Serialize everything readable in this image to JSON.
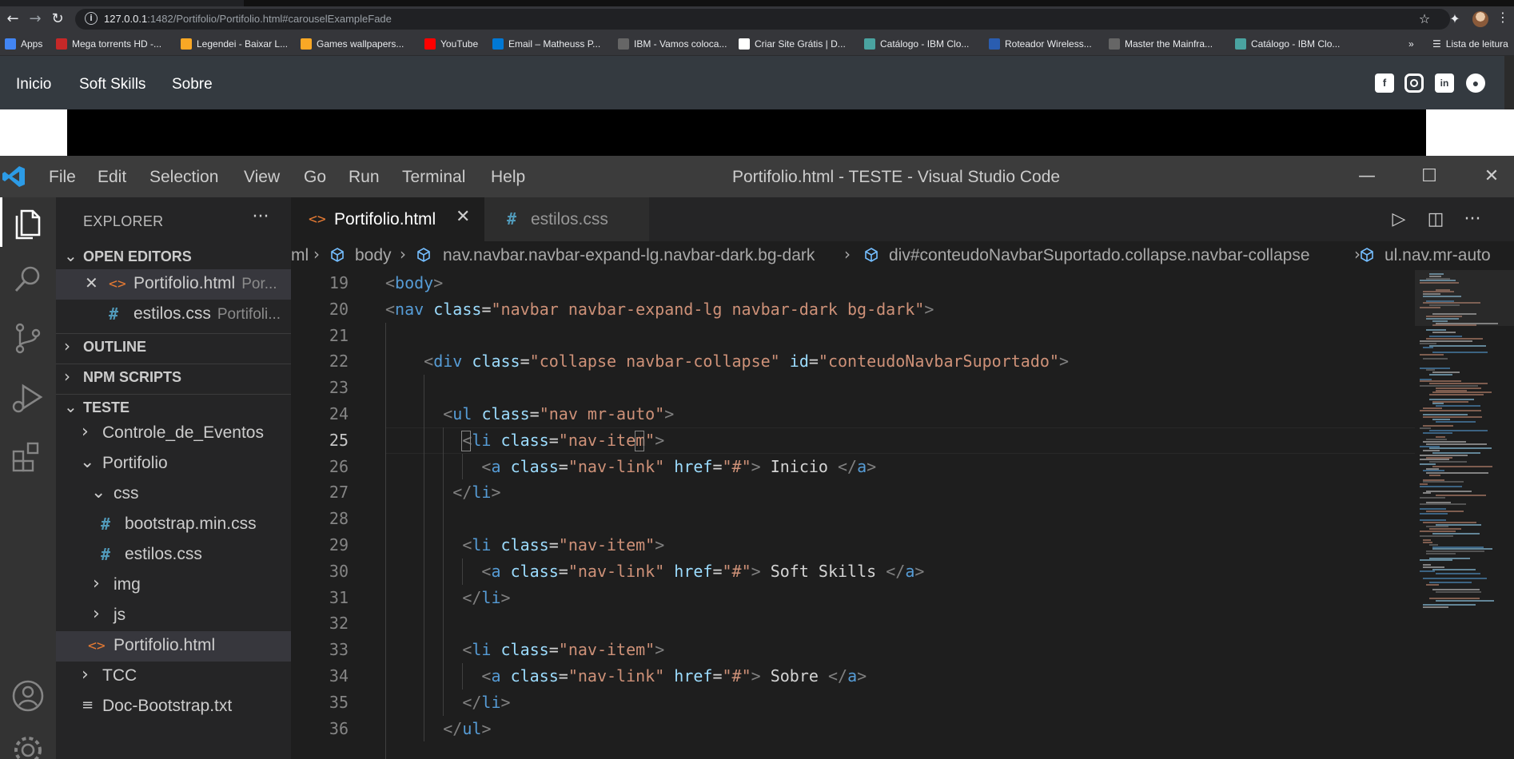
{
  "browser": {
    "url_host": "127.0.0.1",
    "url_rest": ":1482/Portifolio/Portifolio.html#carouselExampleFade",
    "bookmarks": [
      {
        "label": "Apps",
        "icon": "apps-grid-icon",
        "color": "#4285f4"
      },
      {
        "label": "Mega torrents HD -...",
        "icon": "hd-icon",
        "color": "#c62828"
      },
      {
        "label": "Legendei - Baixar L...",
        "icon": "legendei-icon",
        "color": "#f9a825"
      },
      {
        "label": "Games wallpapers...",
        "icon": "games-icon",
        "color": "#f9a825"
      },
      {
        "label": "YouTube",
        "icon": "youtube-icon",
        "color": "#ff0000"
      },
      {
        "label": "Email – Matheuss P...",
        "icon": "outlook-icon",
        "color": "#0078d4"
      },
      {
        "label": "IBM - Vamos coloca...",
        "icon": "ibm-icon",
        "color": "#666666"
      },
      {
        "label": "Criar Site Grátis | D...",
        "icon": "wix-icon",
        "color": "#ffffff"
      },
      {
        "label": "Catálogo - IBM Clo...",
        "icon": "ibm-cloud-icon",
        "color": "#4aa3a0"
      },
      {
        "label": "Roteador Wireless...",
        "icon": "router-icon",
        "color": "#2a5db0"
      },
      {
        "label": "Master the Mainfra...",
        "icon": "ibm-icon",
        "color": "#666666"
      },
      {
        "label": "Catálogo - IBM Clo...",
        "icon": "ibm-cloud-icon",
        "color": "#4aa3a0"
      }
    ],
    "more_bookmarks": "»",
    "reading_list": "Lista de leitura"
  },
  "site": {
    "nav": [
      "Inicio",
      "Soft Skills",
      "Sobre"
    ],
    "social": [
      "facebook-icon",
      "instagram-icon",
      "linkedin-icon",
      "github-icon"
    ],
    "bg_color": "#343a40"
  },
  "vscode": {
    "menu": [
      "File",
      "Edit",
      "Selection",
      "View",
      "Go",
      "Run",
      "Terminal",
      "Help"
    ],
    "window_title": "Portifolio.html - TESTE - Visual Studio Code",
    "explorer": {
      "header": "EXPLORER",
      "open_editors_label": "OPEN EDITORS",
      "open_editors": [
        {
          "name": "Portifolio.html",
          "desc": "Por...",
          "type": "html"
        },
        {
          "name": "estilos.css",
          "desc": "Portifoli...",
          "type": "css"
        }
      ],
      "outline_label": "OUTLINE",
      "npm_label": "NPM SCRIPTS",
      "workspace_label": "TESTE",
      "tree": [
        {
          "name": "Controle_de_Eventos",
          "type": "folder",
          "expanded": false
        },
        {
          "name": "Portifolio",
          "type": "folder",
          "expanded": true
        },
        {
          "name": "css",
          "type": "folder",
          "expanded": true
        },
        {
          "name": "bootstrap.min.css",
          "type": "css"
        },
        {
          "name": "estilos.css",
          "type": "css"
        },
        {
          "name": "img",
          "type": "folder",
          "expanded": false
        },
        {
          "name": "js",
          "type": "folder",
          "expanded": false
        },
        {
          "name": "Portifolio.html",
          "type": "html"
        },
        {
          "name": "TCC",
          "type": "folder",
          "expanded": false
        },
        {
          "name": "Doc-Bootstrap.txt",
          "type": "txt"
        }
      ]
    },
    "tabs": [
      {
        "label": "Portifolio.html",
        "active": true
      },
      {
        "label": "estilos.css",
        "active": false
      }
    ],
    "breadcrumb": [
      "ml",
      "body",
      "nav.navbar.navbar-expand-lg.navbar-dark.bg-dark",
      "div#conteudoNavbarSuportado.collapse.navbar-collapse",
      "ul.nav.mr-auto"
    ],
    "current_line": 25,
    "code_lines": [
      {
        "n": 19,
        "tokens": [
          [
            "p",
            "<"
          ],
          [
            "tag",
            "body"
          ],
          [
            "p",
            ">"
          ]
        ]
      },
      {
        "n": 20,
        "tokens": [
          [
            "p",
            "<"
          ],
          [
            "tag",
            "nav"
          ],
          [
            "txt",
            " "
          ],
          [
            "attr",
            "class"
          ],
          [
            "txt",
            "="
          ],
          [
            "str",
            "\"navbar navbar-expand-lg navbar-dark bg-dark\""
          ],
          [
            "p",
            ">"
          ]
        ]
      },
      {
        "n": 21,
        "tokens": []
      },
      {
        "n": 22,
        "tokens": [
          [
            "txt",
            "    "
          ],
          [
            "p",
            "<"
          ],
          [
            "tag",
            "div"
          ],
          [
            "txt",
            " "
          ],
          [
            "attr",
            "class"
          ],
          [
            "txt",
            "="
          ],
          [
            "str",
            "\"collapse navbar-collapse\""
          ],
          [
            "txt",
            " "
          ],
          [
            "attr",
            "id"
          ],
          [
            "txt",
            "="
          ],
          [
            "str",
            "\"conteudoNavbarSuportado\""
          ],
          [
            "p",
            ">"
          ]
        ]
      },
      {
        "n": 23,
        "tokens": []
      },
      {
        "n": 24,
        "tokens": [
          [
            "txt",
            "      "
          ],
          [
            "p",
            "<"
          ],
          [
            "tag",
            "ul"
          ],
          [
            "txt",
            " "
          ],
          [
            "attr",
            "class"
          ],
          [
            "txt",
            "="
          ],
          [
            "str",
            "\"nav mr-auto\""
          ],
          [
            "p",
            ">"
          ]
        ]
      },
      {
        "n": 25,
        "tokens": [
          [
            "txt",
            "        "
          ],
          [
            "p",
            "<"
          ],
          [
            "tag",
            "li"
          ],
          [
            "txt",
            " "
          ],
          [
            "attr",
            "class"
          ],
          [
            "txt",
            "="
          ],
          [
            "str",
            "\"nav-item\""
          ],
          [
            "p",
            ">"
          ]
        ]
      },
      {
        "n": 26,
        "tokens": [
          [
            "txt",
            "          "
          ],
          [
            "p",
            "<"
          ],
          [
            "tag",
            "a"
          ],
          [
            "txt",
            " "
          ],
          [
            "attr",
            "class"
          ],
          [
            "txt",
            "="
          ],
          [
            "str",
            "\"nav-link\""
          ],
          [
            "txt",
            " "
          ],
          [
            "attr",
            "href"
          ],
          [
            "txt",
            "="
          ],
          [
            "str",
            "\"#\""
          ],
          [
            "p",
            ">"
          ],
          [
            "txt",
            " Inicio "
          ],
          [
            "p",
            "</"
          ],
          [
            "tag",
            "a"
          ],
          [
            "p",
            ">"
          ]
        ]
      },
      {
        "n": 27,
        "tokens": [
          [
            "txt",
            "       "
          ],
          [
            "p",
            "</"
          ],
          [
            "tag",
            "li"
          ],
          [
            "p",
            ">"
          ]
        ]
      },
      {
        "n": 28,
        "tokens": []
      },
      {
        "n": 29,
        "tokens": [
          [
            "txt",
            "        "
          ],
          [
            "p",
            "<"
          ],
          [
            "tag",
            "li"
          ],
          [
            "txt",
            " "
          ],
          [
            "attr",
            "class"
          ],
          [
            "txt",
            "="
          ],
          [
            "str",
            "\"nav-item\""
          ],
          [
            "p",
            ">"
          ]
        ]
      },
      {
        "n": 30,
        "tokens": [
          [
            "txt",
            "          "
          ],
          [
            "p",
            "<"
          ],
          [
            "tag",
            "a"
          ],
          [
            "txt",
            " "
          ],
          [
            "attr",
            "class"
          ],
          [
            "txt",
            "="
          ],
          [
            "str",
            "\"nav-link\""
          ],
          [
            "txt",
            " "
          ],
          [
            "attr",
            "href"
          ],
          [
            "txt",
            "="
          ],
          [
            "str",
            "\"#\""
          ],
          [
            "p",
            ">"
          ],
          [
            "txt",
            " Soft Skills "
          ],
          [
            "p",
            "</"
          ],
          [
            "tag",
            "a"
          ],
          [
            "p",
            ">"
          ]
        ]
      },
      {
        "n": 31,
        "tokens": [
          [
            "txt",
            "        "
          ],
          [
            "p",
            "</"
          ],
          [
            "tag",
            "li"
          ],
          [
            "p",
            ">"
          ]
        ]
      },
      {
        "n": 32,
        "tokens": []
      },
      {
        "n": 33,
        "tokens": [
          [
            "txt",
            "        "
          ],
          [
            "p",
            "<"
          ],
          [
            "tag",
            "li"
          ],
          [
            "txt",
            " "
          ],
          [
            "attr",
            "class"
          ],
          [
            "txt",
            "="
          ],
          [
            "str",
            "\"nav-item\""
          ],
          [
            "p",
            ">"
          ]
        ]
      },
      {
        "n": 34,
        "tokens": [
          [
            "txt",
            "          "
          ],
          [
            "p",
            "<"
          ],
          [
            "tag",
            "a"
          ],
          [
            "txt",
            " "
          ],
          [
            "attr",
            "class"
          ],
          [
            "txt",
            "="
          ],
          [
            "str",
            "\"nav-link\""
          ],
          [
            "txt",
            " "
          ],
          [
            "attr",
            "href"
          ],
          [
            "txt",
            "="
          ],
          [
            "str",
            "\"#\""
          ],
          [
            "p",
            ">"
          ],
          [
            "txt",
            " Sobre "
          ],
          [
            "p",
            "</"
          ],
          [
            "tag",
            "a"
          ],
          [
            "p",
            ">"
          ]
        ]
      },
      {
        "n": 35,
        "tokens": [
          [
            "txt",
            "        "
          ],
          [
            "p",
            "</"
          ],
          [
            "tag",
            "li"
          ],
          [
            "p",
            ">"
          ]
        ]
      },
      {
        "n": 36,
        "tokens": [
          [
            "txt",
            "      "
          ],
          [
            "p",
            "</"
          ],
          [
            "tag",
            "ul"
          ],
          [
            "p",
            ">"
          ]
        ]
      }
    ]
  }
}
